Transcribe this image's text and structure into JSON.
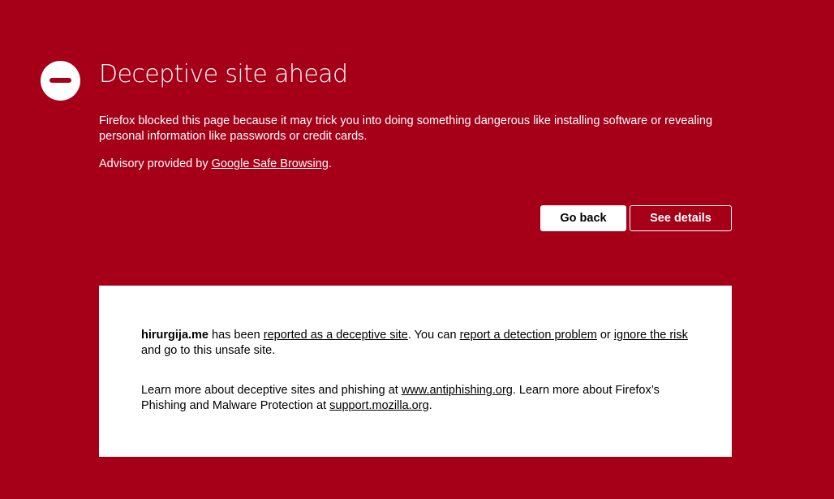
{
  "colors": {
    "background": "#a50017",
    "panel": "#ffffff",
    "text_on_background": "#ffffff",
    "text_on_panel": "#000000"
  },
  "icon": {
    "name": "stop-icon"
  },
  "header": {
    "title": "Deceptive site ahead"
  },
  "description": "Firefox blocked this page because it may trick you into doing something dangerous like installing software or revealing personal information like passwords or credit cards.",
  "advisory": {
    "prefix": "Advisory provided by ",
    "link_text": "Google Safe Browsing",
    "suffix": "."
  },
  "buttons": {
    "go_back": "Go back",
    "see_details": "See details"
  },
  "details": {
    "site": "hirurgija.me",
    "text_1": " has been ",
    "link_reported": "reported as a deceptive site",
    "text_2": ". You can ",
    "link_report_problem": "report a detection problem",
    "text_3": " or ",
    "link_ignore_risk": "ignore the risk",
    "text_4": " and go to this unsafe site.",
    "learn_text_1": "Learn more about deceptive sites and phishing at ",
    "link_antiphishing": "www.antiphishing.org",
    "learn_text_2": ". Learn more about Firefox’s Phishing and Malware Protection at ",
    "link_support": "support.mozilla.org",
    "learn_text_3": "."
  }
}
